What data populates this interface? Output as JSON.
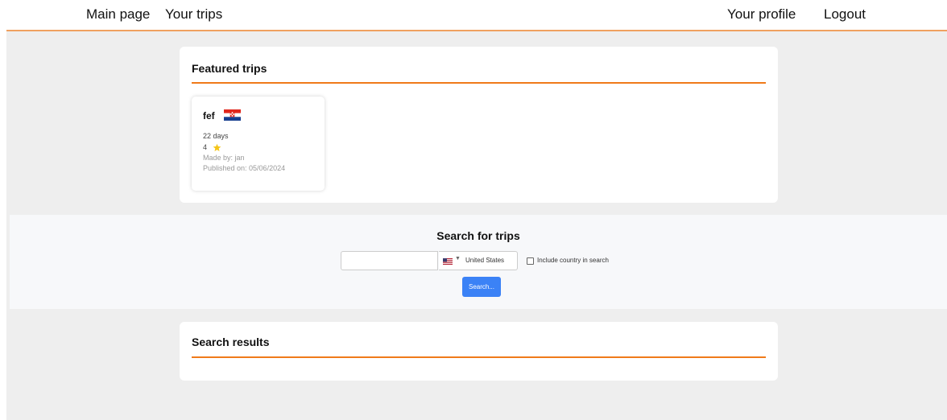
{
  "nav": {
    "main_page": "Main page",
    "your_trips": "Your trips",
    "your_profile": "Your profile",
    "logout": "Logout"
  },
  "featured": {
    "title": "Featured trips",
    "trips": [
      {
        "name": "fef",
        "flag": "croatia-flag",
        "duration": "22 days",
        "rating": "4",
        "made_by": "Made by: jan",
        "published": "Published on: 05/06/2024"
      }
    ]
  },
  "search": {
    "title": "Search for trips",
    "input_value": "",
    "country": "United States",
    "country_flag": "us-flag",
    "include_label": "Include country in search",
    "include_checked": false,
    "button_label": "Search..."
  },
  "results": {
    "title": "Search results"
  },
  "colors": {
    "accent": "#f07a1a",
    "button": "#3b82f6",
    "page_bg": "#eeeeee"
  }
}
